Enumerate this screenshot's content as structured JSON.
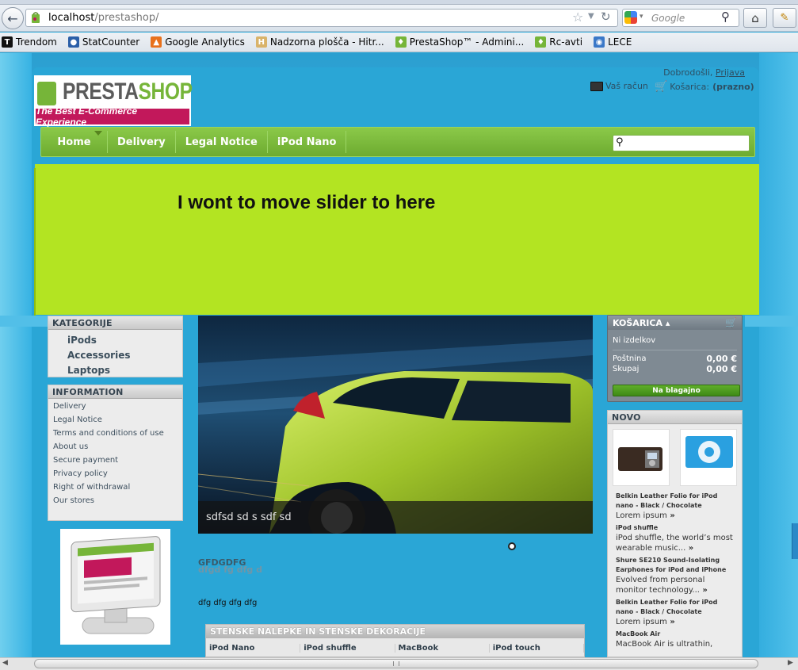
{
  "browser": {
    "url_host": "localhost",
    "url_path": "/prestashop/",
    "search_placeholder": "Google",
    "bookmarks": [
      {
        "label": "Trendom",
        "icon": "trendom-icon",
        "color": "#111111",
        "glyph": "T"
      },
      {
        "label": "StatCounter",
        "icon": "statcounter-icon",
        "color": "#2b5fa8",
        "glyph": "●"
      },
      {
        "label": "Google Analytics",
        "icon": "analytics-icon",
        "color": "#e8711c",
        "glyph": "▲"
      },
      {
        "label": "Nadzorna plošča - Hitr...",
        "icon": "dashboard-icon",
        "color": "#d9b36a",
        "glyph": "H"
      },
      {
        "label": "PrestaShop™ - Admini...",
        "icon": "prestashop-icon",
        "color": "#76b539",
        "glyph": "♦"
      },
      {
        "label": "Rc-avti",
        "icon": "prestashop-icon",
        "color": "#76b539",
        "glyph": "♦"
      },
      {
        "label": "LECE",
        "icon": "lece-icon",
        "color": "#3a78c8",
        "glyph": "◉"
      }
    ]
  },
  "header": {
    "logo_word1": "PRESTA",
    "logo_word2": "SHOP",
    "logo_tagline": "The Best E-Commerce Experience",
    "welcome": "Dobrodošli,",
    "login": "Prijava",
    "account": "Vaš račun",
    "cart_label": "Košarica:",
    "cart_status": "(prazno)"
  },
  "menu": [
    "Home",
    "Delivery",
    "Legal Notice",
    "iPod Nano"
  ],
  "banner_text": "I wont to move slider to here",
  "categories": {
    "title": "KATEGORIJE",
    "items": [
      "iPods",
      "Accessories",
      "Laptops"
    ]
  },
  "information": {
    "title": "INFORMATION",
    "items": [
      "Delivery",
      "Legal Notice",
      "Terms and conditions of use",
      "About us",
      "Secure payment",
      "Privacy policy",
      "Right of withdrawal",
      "Our stores"
    ]
  },
  "slider": {
    "caption": "sdfsd sd s sdf sd"
  },
  "content": {
    "title": "GFDGDFG",
    "subtitle": "dfgd fg dfg d",
    "text": "dfg dfg dfg dfg"
  },
  "table": {
    "title": "STENSKE NALEPKE IN STENSKE DEKORACIJE",
    "columns": [
      "iPod Nano",
      "iPod shuffle",
      "MacBook",
      "iPod touch"
    ]
  },
  "cart": {
    "title": "KOŠARICA",
    "empty": "Ni izdelkov",
    "shipping_label": "Poštnina",
    "shipping_value": "0,00 €",
    "total_label": "Skupaj",
    "total_value": "0,00 €",
    "checkout": "Na blagajno"
  },
  "new_products": {
    "title": "NOVO",
    "items": [
      {
        "title": "Belkin Leather Folio for iPod nano - Black / Chocolate",
        "desc": "Lorem ipsum"
      },
      {
        "title": "iPod shuffle",
        "desc": "iPod shuffle, the world’s most wearable music..."
      },
      {
        "title": "Shure SE210 Sound-Isolating Earphones for iPod and iPhone",
        "desc": "Evolved from personal monitor technology..."
      },
      {
        "title": "Belkin Leather Folio for iPod nano - Black / Chocolate",
        "desc": "Lorem ipsum"
      },
      {
        "title": "MacBook Air",
        "desc": "MacBook Air is ultrathin,"
      }
    ]
  },
  "colors": {
    "menu_green": "#76b539",
    "banner_green": "#b3e422",
    "page_blue": "#2aa6d6"
  }
}
